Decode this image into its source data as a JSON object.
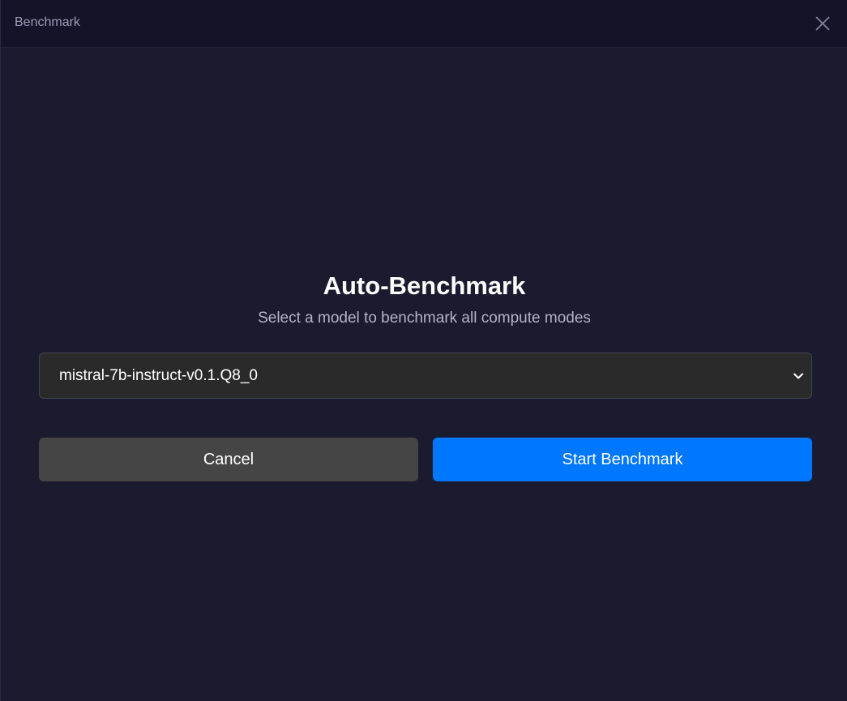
{
  "window": {
    "title": "Benchmark"
  },
  "dialog": {
    "heading": "Auto-Benchmark",
    "subheading": "Select a model to benchmark all compute modes",
    "model_select": {
      "selected": "mistral-7b-instruct-v0.1.Q8_0"
    },
    "cancel_label": "Cancel",
    "start_label": "Start Benchmark"
  },
  "icons": {
    "close": "close-icon",
    "dropdown": "chevron-down-icon"
  },
  "colors": {
    "background": "#1b1b2f",
    "titlebar": "#141428",
    "primary": "#0077ff",
    "secondary_button": "#454545",
    "select_background": "#2a2a2a"
  }
}
